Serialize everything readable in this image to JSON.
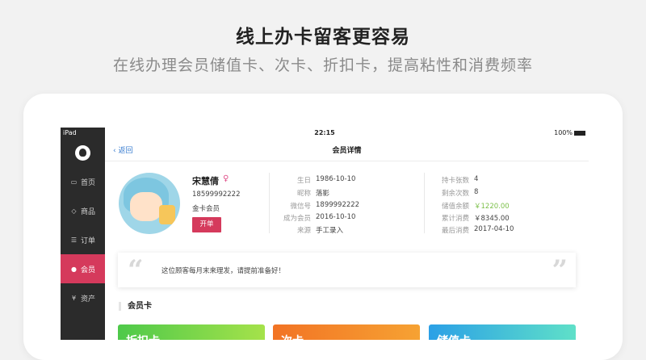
{
  "hero": {
    "title": "线上办卡留客更容易",
    "subtitle": "在线办理会员储值卡、次卡、折扣卡，提高粘性和消费频率"
  },
  "status_bar": {
    "carrier": "iPad",
    "time": "22:15",
    "battery": "100%"
  },
  "sidebar": {
    "items": [
      {
        "label": "首页",
        "icon": "chat-icon"
      },
      {
        "label": "商品",
        "icon": "tag-icon"
      },
      {
        "label": "订单",
        "icon": "list-icon"
      },
      {
        "label": "会员",
        "icon": "person-icon",
        "active": true
      },
      {
        "label": "资产",
        "icon": "yen-icon"
      }
    ]
  },
  "nav": {
    "back_label": "返回",
    "title": "会员详情"
  },
  "member": {
    "name": "宋慧倩",
    "gender_symbol": "♀",
    "phone": "18599992222",
    "level": "金卡会员",
    "open_button": "开单"
  },
  "details_left": [
    {
      "label": "生日",
      "value": "1986-10-10"
    },
    {
      "label": "昵称",
      "value": "落影"
    },
    {
      "label": "微信号",
      "value": "1899992222"
    },
    {
      "label": "成为会员",
      "value": "2016-10-10"
    },
    {
      "label": "来源",
      "value": "手工录入"
    }
  ],
  "details_right": [
    {
      "label": "持卡张数",
      "value": "4"
    },
    {
      "label": "剩余次数",
      "value": "8"
    },
    {
      "label": "储值余额",
      "value": "￥1220.00"
    },
    {
      "label": "累计消费",
      "value": "￥8345.00"
    },
    {
      "label": "最后消费",
      "value": "2017-04-10"
    }
  ],
  "note": {
    "text": "这位顾客每月末来理发，请提前准备好！"
  },
  "cards_section": {
    "title": "会员卡"
  },
  "cards": [
    {
      "label": "折扣卡"
    },
    {
      "label": "次卡"
    },
    {
      "label": "储值卡"
    }
  ],
  "colors": {
    "accent": "#d53a5c",
    "sidebar": "#2b2b2b",
    "link": "#3a7dd0",
    "balance": "#7cc04a"
  }
}
